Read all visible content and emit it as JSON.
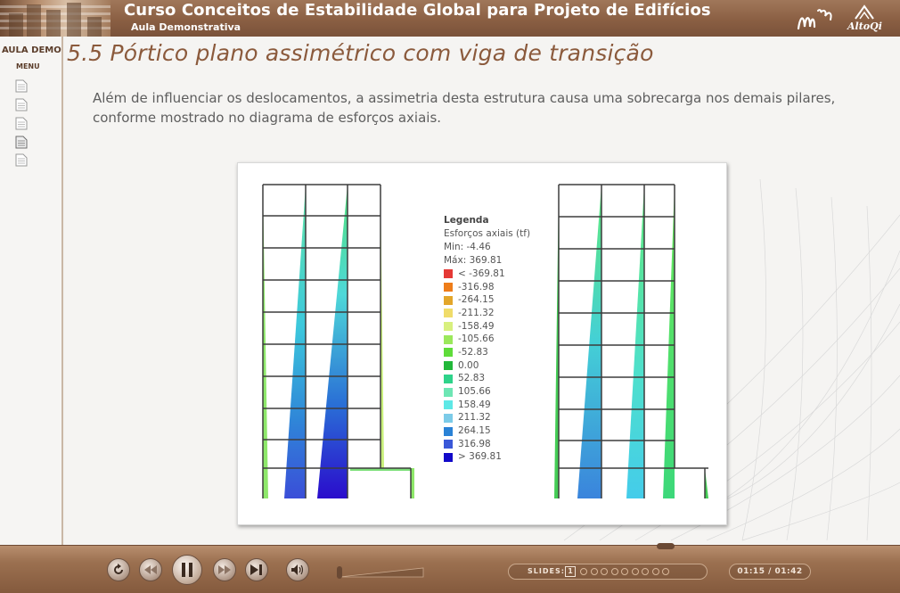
{
  "header": {
    "course_title": "Curso Conceitos de Estabilidade Global para Projeto de Edifícios",
    "course_subtitle": "Aula Demonstrativa",
    "logo_right": "AltoQi",
    "logo_left_icon": "mn-logo"
  },
  "sidebar": {
    "aula_demo": "AULA DEMO",
    "menu_label": "MENU",
    "items": [
      {
        "icon": "page-icon"
      },
      {
        "icon": "page-icon"
      },
      {
        "icon": "page-icon"
      },
      {
        "icon": "page-icon",
        "active": true
      },
      {
        "icon": "page-icon"
      }
    ]
  },
  "slide": {
    "title": "5.5 Pórtico plano assimétrico com viga de transição",
    "text": "Além de influenciar os deslocamentos, a assimetria desta estrutura causa uma sobrecarga nos demais pilares, conforme mostrado no diagrama de esforços axiais."
  },
  "legend": {
    "title": "Legenda",
    "subtitle": "Esforços axiais (tf)",
    "min": "Min: -4.46",
    "max": "Máx: 369.81",
    "entries": [
      {
        "label": "< -369.81",
        "color": "#e53935"
      },
      {
        "label": "-316.98",
        "color": "#ee7d1a"
      },
      {
        "label": "-264.15",
        "color": "#e3a62a"
      },
      {
        "label": "-211.32",
        "color": "#f0dc6a"
      },
      {
        "label": "-158.49",
        "color": "#d8f07e"
      },
      {
        "label": "-105.66",
        "color": "#9be85c"
      },
      {
        "label": "-52.83",
        "color": "#5fdc3a"
      },
      {
        "label": "0.00",
        "color": "#22b83a"
      },
      {
        "label": "52.83",
        "color": "#2ed38a"
      },
      {
        "label": "105.66",
        "color": "#6ee6b4"
      },
      {
        "label": "158.49",
        "color": "#5ee8e6"
      },
      {
        "label": "211.32",
        "color": "#7ccbe8"
      },
      {
        "label": "264.15",
        "color": "#2a82d6"
      },
      {
        "label": "316.98",
        "color": "#3a58d8"
      },
      {
        "label": "> 369.81",
        "color": "#1209c9"
      }
    ]
  },
  "player": {
    "slides_label": "SLIDES:",
    "current_slide": "1",
    "slide_count": 10,
    "time": "01:15 / 01:42",
    "accent": "#8a5f43"
  }
}
